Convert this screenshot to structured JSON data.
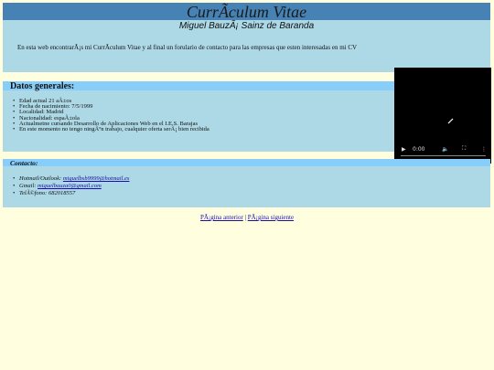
{
  "header": {
    "title": "CurrÃculum Vitae",
    "subtitle": "Miguel BauzÃ¡ Sainz de Baranda"
  },
  "intro": {
    "text": "En esta web encontrarÃ¡s mi CurrÃculum Vitae y al final un forulario de contacto para las empresas que esten interesadas en mi CV"
  },
  "general": {
    "heading": "Datos generales:",
    "items": [
      "Edad actual 21 aÃ±os",
      "Fecha de nacimiento: 7/5/1999",
      "Localidad: Madrid",
      "Nacionalidad: espaÃ±ola",
      "Actualmetne cursando Desarrollo de Aplicaciones Web en el I.E.S. Barajas",
      "En este momento no tengo ningÃºn trabajo, cualquier oferta serÃ¡ bien recibida"
    ]
  },
  "video": {
    "time": "0:00",
    "play_icon": "play-icon",
    "volume_icon": "volume-icon",
    "fullscreen_icon": "fullscreen-icon",
    "menu_icon": "more-vert-icon"
  },
  "contact": {
    "heading": "Contacto:",
    "hotmail_label": "Hotmail/Outlook:",
    "hotmail_value": "miguelbsb9999@hotmail.es",
    "gmail_label": "Gmail:",
    "gmail_value": "miguelbauza0@gmail.com",
    "phone_label": "TelÃ©fono:",
    "phone_value": "682018557"
  },
  "nav": {
    "prev": "PÃ¡gina anterior",
    "separator": "|",
    "next": "PÃ¡gina siguiente"
  }
}
